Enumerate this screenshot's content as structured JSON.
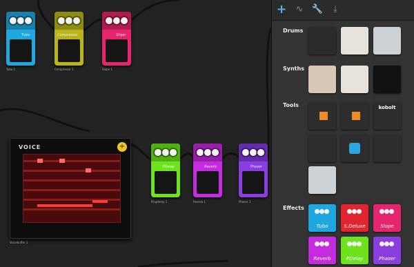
{
  "workspace": {
    "pedals_top": [
      {
        "label": "Tubo",
        "caption": "Tubo 1",
        "color": "#1fa8e0"
      },
      {
        "label": "Compressor",
        "caption": "Compressor 1",
        "color": "#b8b41a"
      },
      {
        "label": "Slope",
        "caption": "Slope 1",
        "color": "#e6256e"
      }
    ],
    "pedals_mid": [
      {
        "label": "PDelay",
        "caption": "Pingdelay 1",
        "color": "#6fe21e"
      },
      {
        "label": "Reverb",
        "caption": "Reverb 1",
        "color": "#c52cdf"
      },
      {
        "label": "Phaser",
        "caption": "Phaser 1",
        "color": "#8a3ee0"
      }
    ],
    "voice_device": {
      "logo": "VOICE",
      "caption": "Voicebuffer 1"
    },
    "add_button_symbol": "+"
  },
  "panel": {
    "tabs": [
      {
        "name": "add",
        "symbol": "+"
      },
      {
        "name": "waveform",
        "symbol": "∿"
      },
      {
        "name": "settings",
        "symbol": "🔧"
      },
      {
        "name": "export",
        "symbol": "⤓"
      }
    ],
    "sections": {
      "drums": "Drums",
      "synths": "Synths",
      "tools": "Tools",
      "effects": "Effects"
    },
    "tools_kobolt_label": "kobolt",
    "effects": [
      {
        "label": "Tubo",
        "color": "#1fa8e0"
      },
      {
        "label": "S.Deluxe",
        "color": "#e02430"
      },
      {
        "label": "Slope",
        "color": "#e6256e"
      },
      {
        "label": "Reverb",
        "color": "#c52cdf"
      },
      {
        "label": "PDelay",
        "color": "#6fe21e"
      },
      {
        "label": "Phaser",
        "color": "#8a3ee0"
      }
    ]
  }
}
